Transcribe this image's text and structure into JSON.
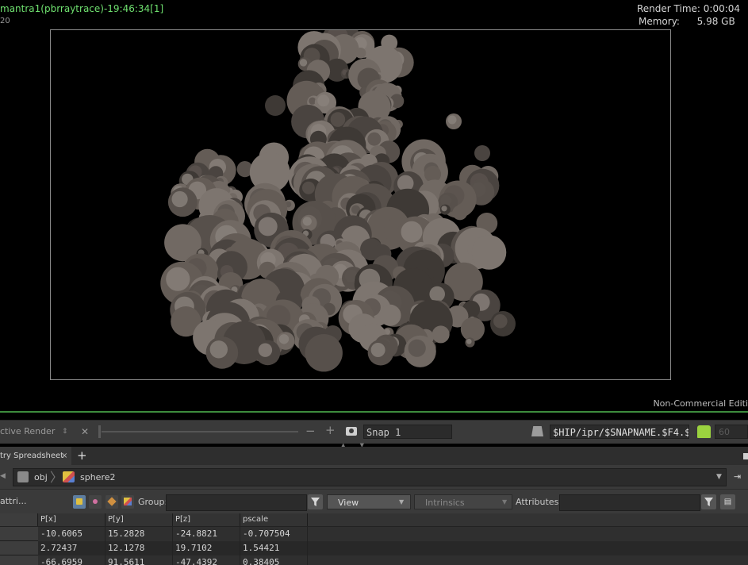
{
  "render_view": {
    "title": "mantra1(pbrraytrace)-19:46:34[1]",
    "frame_info": "20",
    "render_time_label": "Render Time:",
    "render_time_value": "0:00:04",
    "memory_label": "Memory:",
    "memory_value": "5.98 GB",
    "watermark": "Non-Commercial Editi"
  },
  "render_toolbar": {
    "renderer_label": "ctive Render",
    "snap_value": "Snap 1",
    "output_path": "$HIP/ipr/$SNAPNAME.$F4.$S",
    "port_value": "60"
  },
  "tabs": {
    "active_label": "try Spreadsheet",
    "close_symbol": "×",
    "add_symbol": "+"
  },
  "path_bar": {
    "segments": [
      "obj",
      "sphere2"
    ]
  },
  "filter_bar": {
    "attrib_label": "attri...",
    "group_label": "Group:",
    "group_value": "",
    "view_label": "View",
    "intrinsics_label": "Intrinsics",
    "attributes_label": "Attributes:",
    "attributes_value": ""
  },
  "spreadsheet": {
    "columns": [
      "P[x]",
      "P[y]",
      "P[z]",
      "pscale"
    ],
    "rows": [
      [
        "-10.6065",
        "15.2828",
        "-24.8821",
        "-0.707504"
      ],
      [
        "2.72437",
        "12.1278",
        "19.7102",
        "1.54421"
      ],
      [
        "-66.6959",
        "91.5611",
        "-47.4392",
        "0.38405"
      ]
    ]
  },
  "colors": {
    "title_green": "#6fe06f",
    "accent_green": "#3d8c3d",
    "particle_base": "#5a524d",
    "particle_light": "#8a827c"
  }
}
